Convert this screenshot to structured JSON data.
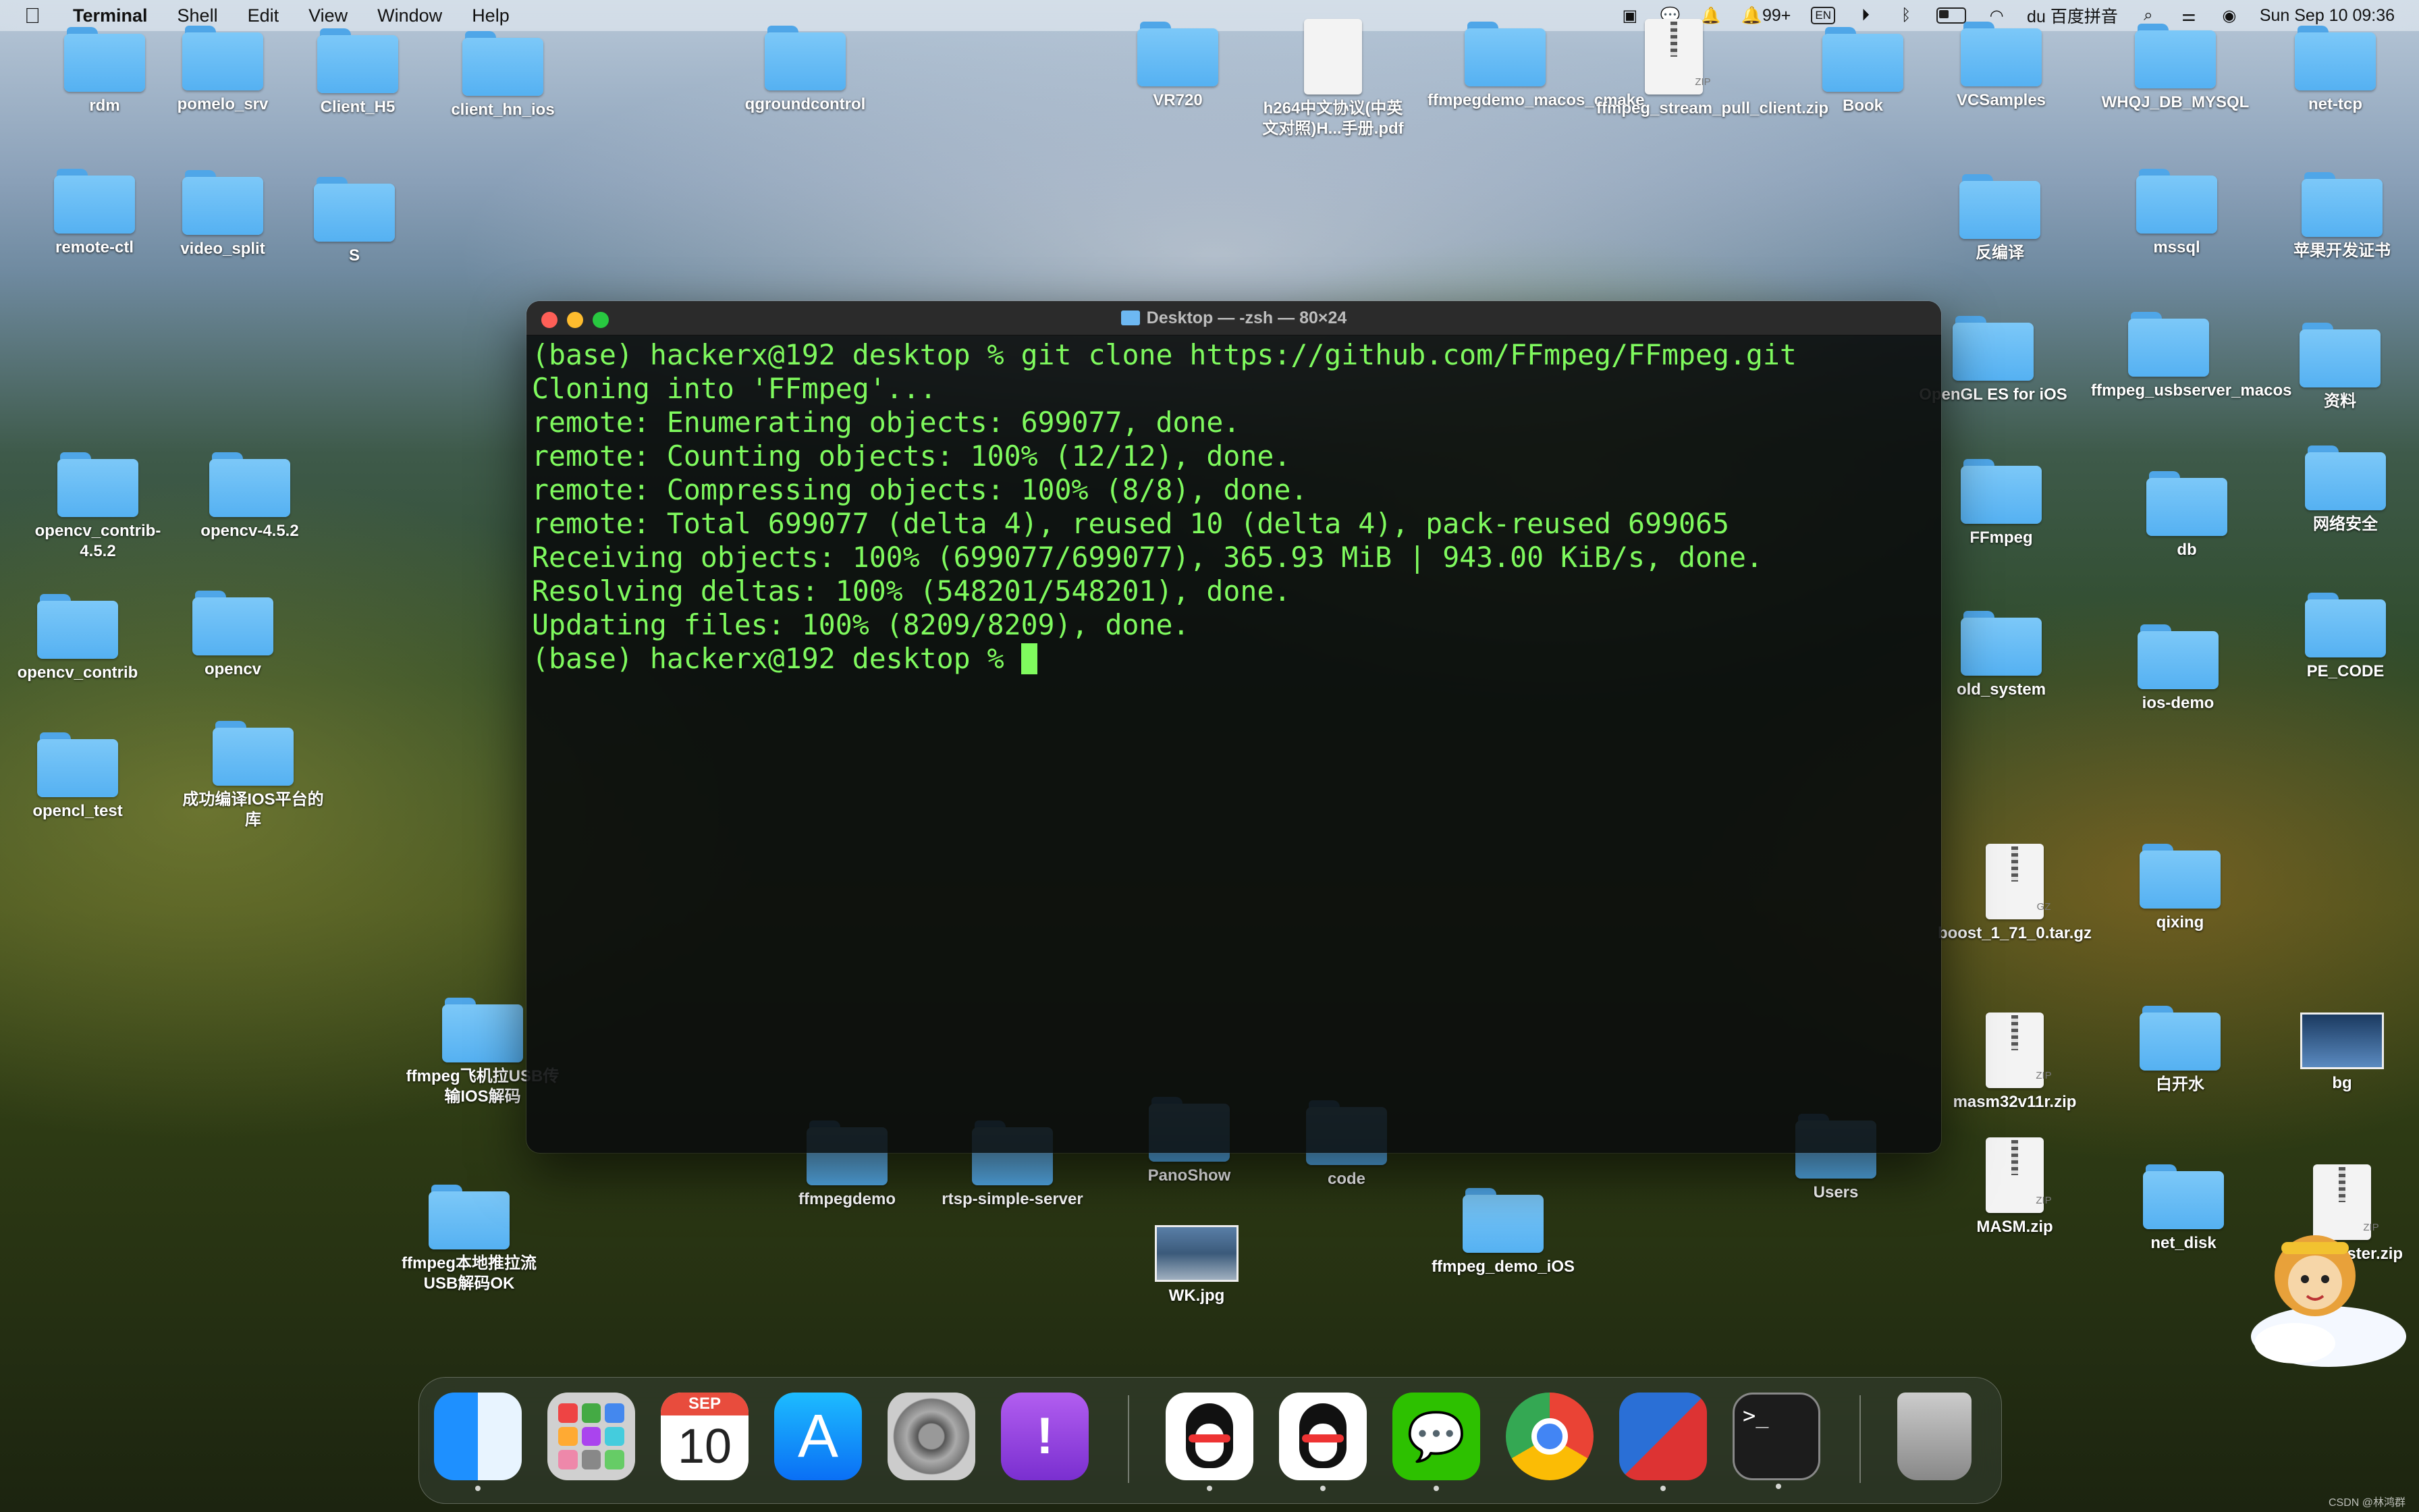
{
  "menubar": {
    "app": "Terminal",
    "menus": [
      "Shell",
      "Edit",
      "View",
      "Window",
      "Help"
    ],
    "badge_count": "99+",
    "input_method": "EN",
    "ime_name": "百度拼音",
    "datetime": "Sun Sep 10  09:36"
  },
  "desktop_items": [
    {
      "label": "rdm",
      "type": "folder"
    },
    {
      "label": "pomelo_srv",
      "type": "folder"
    },
    {
      "label": "Client_H5",
      "type": "folder"
    },
    {
      "label": "client_hn_ios",
      "type": "folder"
    },
    {
      "label": "qgroundcontrol",
      "type": "folder"
    },
    {
      "label": "VR720",
      "type": "folder"
    },
    {
      "label": "h264中文协议(中英文对照)H...手册.pdf",
      "type": "pdf"
    },
    {
      "label": "ffmpegdemo_macos_cmake",
      "type": "folder"
    },
    {
      "label": "ffmpeg_stream_pull_client.zip",
      "type": "zip"
    },
    {
      "label": "Book",
      "type": "folder"
    },
    {
      "label": "VCSamples",
      "type": "folder"
    },
    {
      "label": "WHQJ_DB_MYSQL",
      "type": "folder"
    },
    {
      "label": "net-tcp",
      "type": "folder"
    },
    {
      "label": "remote-ctl",
      "type": "folder"
    },
    {
      "label": "video_split",
      "type": "folder"
    },
    {
      "label": "S",
      "type": "folder"
    },
    {
      "label": "反编译",
      "type": "folder"
    },
    {
      "label": "mssql",
      "type": "folder"
    },
    {
      "label": "苹果开发证书",
      "type": "folder"
    },
    {
      "label": "OpenGL ES for iOS",
      "type": "folder"
    },
    {
      "label": "ffmpeg_usbserver_macos",
      "type": "folder"
    },
    {
      "label": "资料",
      "type": "folder"
    },
    {
      "label": "opencv_contrib-4.5.2",
      "type": "folder"
    },
    {
      "label": "opencv-4.5.2",
      "type": "folder"
    },
    {
      "label": "FFmpeg",
      "type": "folder"
    },
    {
      "label": "db",
      "type": "folder"
    },
    {
      "label": "网络安全",
      "type": "folder"
    },
    {
      "label": "opencv_contrib",
      "type": "folder"
    },
    {
      "label": "opencv",
      "type": "folder"
    },
    {
      "label": "old_system",
      "type": "folder"
    },
    {
      "label": "ios-demo",
      "type": "folder"
    },
    {
      "label": "PE_CODE",
      "type": "folder"
    },
    {
      "label": "opencl_test",
      "type": "folder"
    },
    {
      "label": "成功编译IOS平台的库",
      "type": "folder"
    },
    {
      "label": "boost_1_71_0.tar.gz",
      "type": "gz"
    },
    {
      "label": "qixing",
      "type": "folder"
    },
    {
      "label": "ffmpeg飞机拉USB传输IOS解码",
      "type": "folder"
    },
    {
      "label": "masm32v11r.zip",
      "type": "zip"
    },
    {
      "label": "白开水",
      "type": "folder"
    },
    {
      "label": "bg",
      "type": "image"
    },
    {
      "label": "ffmpegdemo",
      "type": "folder"
    },
    {
      "label": "rtsp-simple-server",
      "type": "folder"
    },
    {
      "label": "PanoShow",
      "type": "folder"
    },
    {
      "label": "code",
      "type": "folder"
    },
    {
      "label": "Users",
      "type": "folder"
    },
    {
      "label": "MASM.zip",
      "type": "zip"
    },
    {
      "label": "net_disk",
      "type": "folder"
    },
    {
      "label": "efSharp-ster.zip",
      "type": "zip"
    },
    {
      "label": "ffmpeg本地推拉流USB解码OK",
      "type": "folder"
    },
    {
      "label": "WK.jpg",
      "type": "image"
    },
    {
      "label": "ffmpeg_demo_iOS",
      "type": "folder"
    }
  ],
  "terminal": {
    "title": "Desktop — -zsh — 80×24",
    "lines": [
      "(base) hackerx@192 desktop % git clone https://github.com/FFmpeg/FFmpeg.git",
      "Cloning into 'FFmpeg'...",
      "remote: Enumerating objects: 699077, done.",
      "remote: Counting objects: 100% (12/12), done.",
      "remote: Compressing objects: 100% (8/8), done.",
      "remote: Total 699077 (delta 4), reused 10 (delta 4), pack-reused 699065",
      "Receiving objects: 100% (699077/699077), 365.93 MiB | 943.00 KiB/s, done.",
      "Resolving deltas: 100% (548201/548201), done.",
      "Updating files: 100% (8209/8209), done."
    ],
    "prompt": "(base) hackerx@192 desktop % "
  },
  "dock": {
    "calendar_month": "SEP",
    "calendar_day": "10",
    "apps": [
      "Finder",
      "Launchpad",
      "Calendar",
      "App Store",
      "System Settings",
      "Feedback Assistant",
      "QQ",
      "QQ",
      "WeChat",
      "Google Chrome",
      "Parallels",
      "Terminal",
      "Trash"
    ]
  },
  "watermark": "CSDN @林鸿群"
}
